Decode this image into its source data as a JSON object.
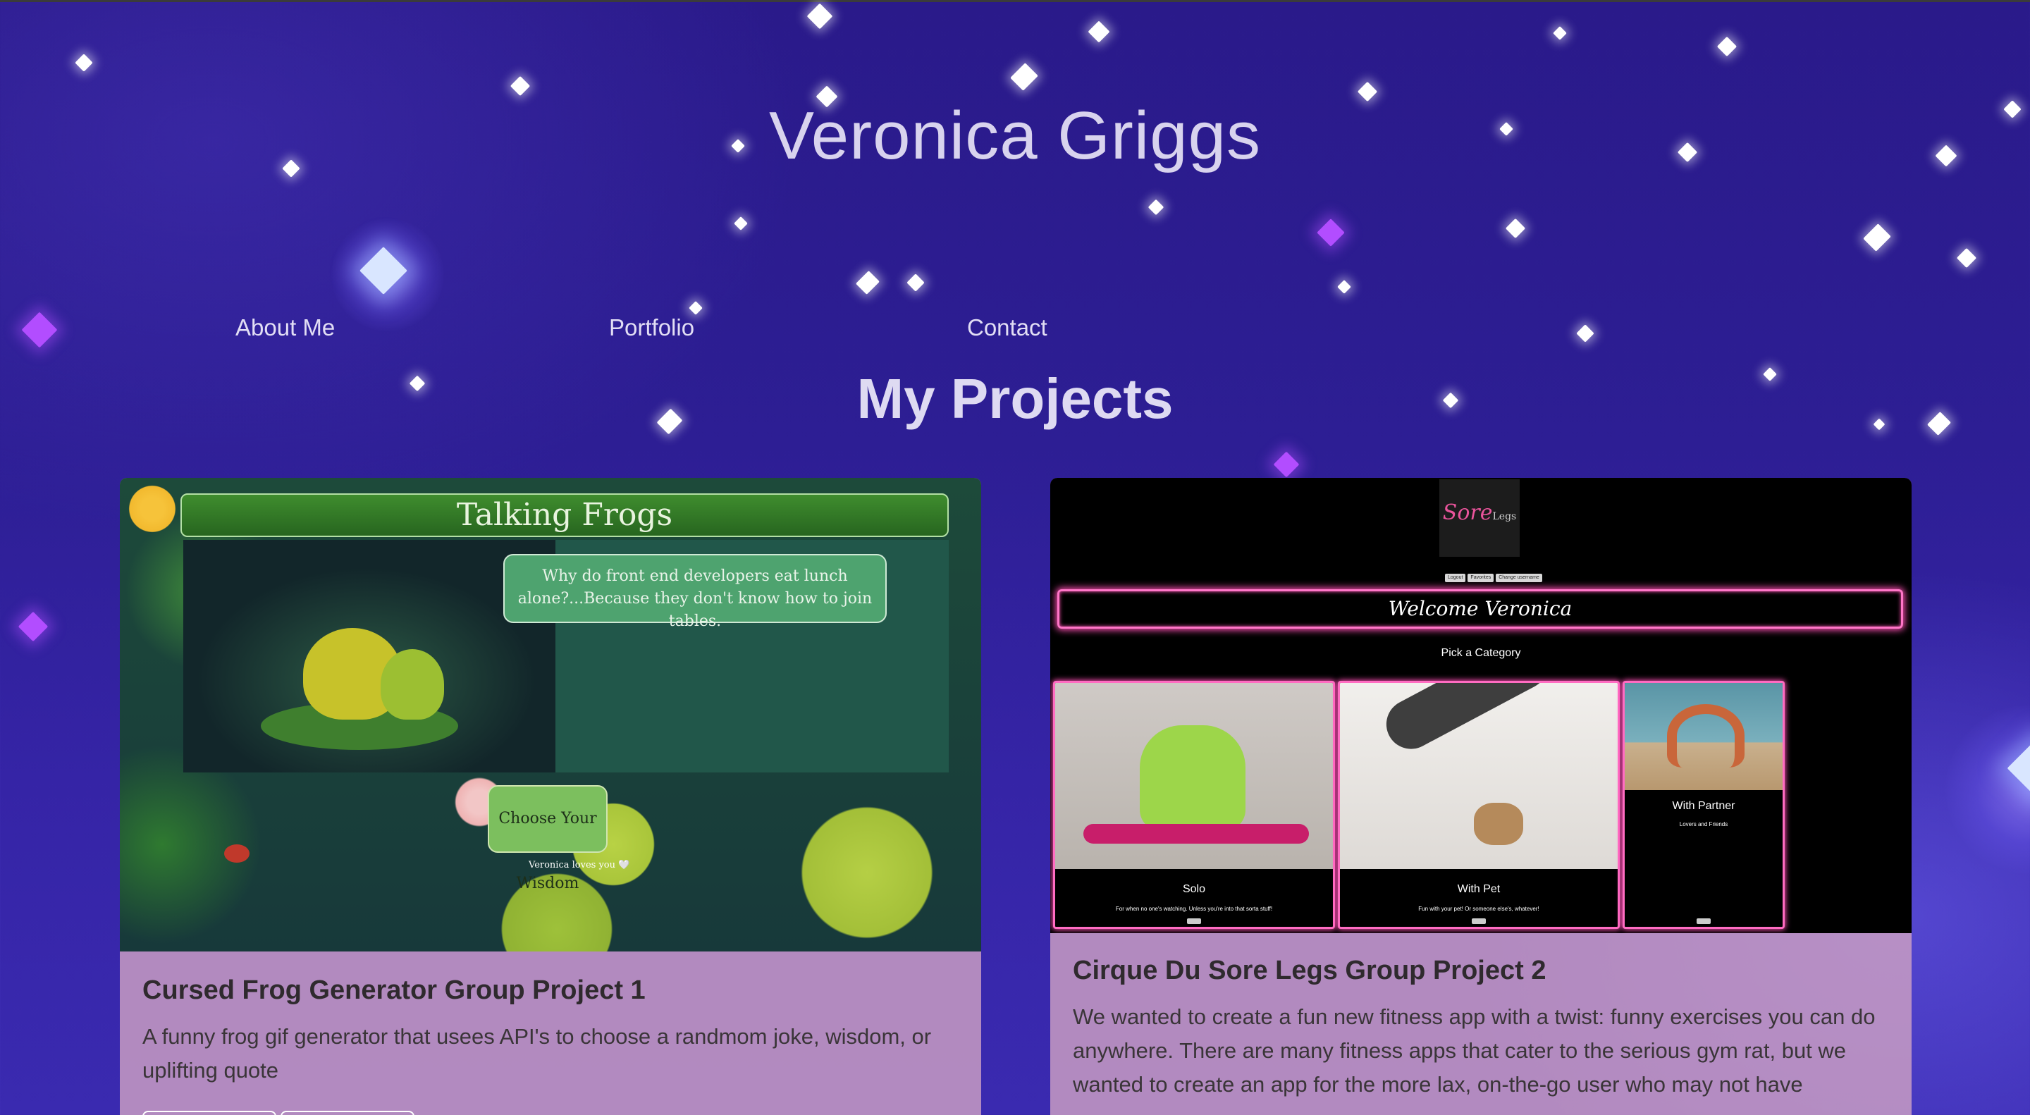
{
  "header": {
    "site_title": "Veronica Griggs"
  },
  "nav": {
    "items": [
      {
        "label": "About Me"
      },
      {
        "label": "Portfolio"
      },
      {
        "label": "Contact"
      }
    ]
  },
  "section": {
    "title": "My Projects"
  },
  "projects": [
    {
      "title": "Cursed Frog Generator Group Project 1",
      "description": "A funny frog gif generator that usees API's to choose a randmom joke, wisdom, or uplifting quote",
      "screenshot": {
        "header": "Talking Frogs",
        "joke": "Why do front end developers eat lunch alone?...Because they don't know how to join tables.",
        "button": "Choose Your Wisdom",
        "credit": "Veronica loves you 🤍"
      }
    },
    {
      "title": "Cirque Du Sore Legs Group Project 2",
      "description": "We wanted to create a fun new fitness app with a twist: funny exercises you can do anywhere. There are many fitness apps that cater to the serious gym rat, but we wanted to create an app for the more lax, on-the-go user who may not have",
      "screenshot": {
        "logo_main": "Sore",
        "logo_sub": "Legs",
        "mini_buttons": [
          "Logout",
          "Favorites",
          "Change username"
        ],
        "welcome": "Welcome Veronica",
        "pick": "Pick a Category",
        "categories": [
          {
            "name": "Solo",
            "desc": "For when no one's watching. Unless you're into that sorta stuff!"
          },
          {
            "name": "With Pet",
            "desc": "Fun with your pet! Or someone else's, whatever!"
          },
          {
            "name": "With Partner",
            "desc": "Lovers and Friends"
          }
        ]
      }
    }
  ]
}
